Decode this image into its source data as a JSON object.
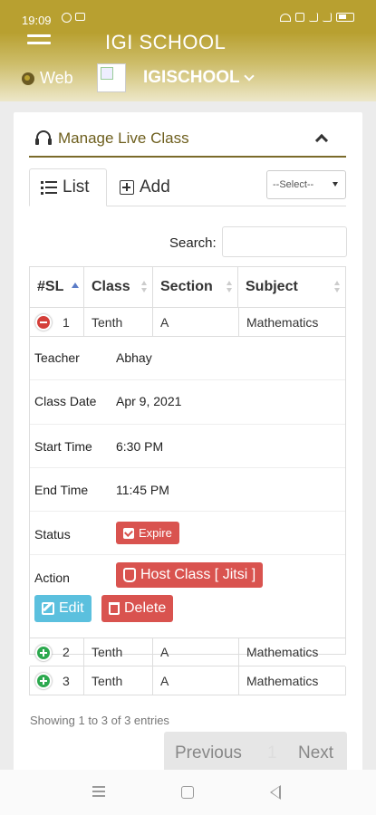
{
  "status_bar": {
    "time": "19:09"
  },
  "header": {
    "app_title": "IGI SCHOOL",
    "web_label": "Web",
    "school_selector": "IGISCHOOL"
  },
  "panel": {
    "title": "Manage Live Class"
  },
  "tabs": {
    "list_label": "List",
    "add_label": "Add",
    "select_value": "--Select--"
  },
  "search": {
    "label": "Search:",
    "value": ""
  },
  "table": {
    "columns": [
      "#SL",
      "Class",
      "Section",
      "Subject"
    ],
    "rows": [
      {
        "sl": "1",
        "class": "Tenth",
        "section": "A",
        "subject": "Mathematics"
      },
      {
        "sl": "2",
        "class": "Tenth",
        "section": "A",
        "subject": "Mathematics"
      },
      {
        "sl": "3",
        "class": "Tenth",
        "section": "A",
        "subject": "Mathematics"
      }
    ],
    "detail": {
      "teacher_label": "Teacher",
      "teacher": "Abhay",
      "class_date_label": "Class Date",
      "class_date": "Apr 9, 2021",
      "start_time_label": "Start Time",
      "start_time": "6:30 PM",
      "end_time_label": "End Time",
      "end_time": "11:45 PM",
      "status_label": "Status",
      "status": "Expire",
      "action_label": "Action",
      "host_button": "Host Class [ Jitsi ]",
      "edit_button": "Edit",
      "delete_button": "Delete"
    }
  },
  "footer": {
    "showing": "Showing 1 to 3 of 3 entries",
    "prev": "Previous",
    "page": "1",
    "next": "Next"
  },
  "colors": {
    "header_gold": "#b8a030",
    "accent_brown": "#6e5f1e",
    "danger": "#d9534f",
    "info": "#5bc0de",
    "success": "#2da94f"
  }
}
